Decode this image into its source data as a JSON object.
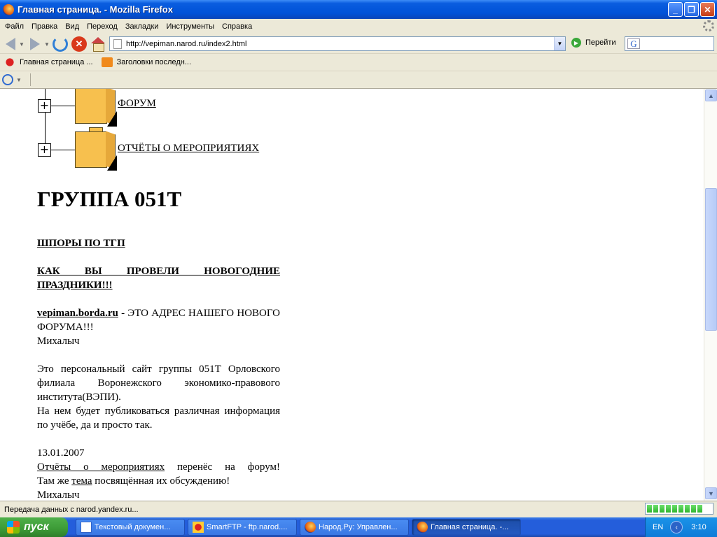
{
  "window": {
    "title": "Главная страница. - Mozilla Firefox"
  },
  "menu": [
    "Файл",
    "Правка",
    "Вид",
    "Переход",
    "Закладки",
    "Инструменты",
    "Справка"
  ],
  "nav": {
    "url": "http://vepiman.narod.ru/index2.html",
    "go_label": "Перейти",
    "search_placeholder": ""
  },
  "bookmarks": [
    {
      "label": "Главная страница ...",
      "icon": "page-icon"
    },
    {
      "label": "Заголовки последн...",
      "icon": "rss-icon"
    }
  ],
  "content": {
    "tree": [
      {
        "label": "ФОРУМ"
      },
      {
        "label": "ОТЧЁТЫ О МЕРОПРИЯТИЯХ"
      }
    ],
    "heading": "ГРУППА 051Т",
    "link_shpory": "ШПОРЫ ПО ТГП",
    "link_holidays": "КАК ВЫ ПРОВЕЛИ НОВОГОДНИЕ ПРАЗДНИКИ!!!",
    "forum_link": "vepiman.borda.ru",
    "forum_text": " - ЭТО АДРЕС НАШЕГО НОВОГО ФОРУМА!!!",
    "signature1": "Михалыч",
    "about1": "Это персональный сайт группы 051Т Орловского филиала Воронежского экономико-правового института(ВЭПИ).",
    "about2": "На нем будет публиковаться различная информация по учёбе, да и просто так.",
    "news_date": "13.01.2007",
    "news_link1": "Отчёты о мероприятиях",
    "news_text1": " перенёс на форум!",
    "news_text2a": "Там же ",
    "news_link2": "тема",
    "news_text2b": " посвящённая их обсуждению!",
    "signature2": "Михалыч"
  },
  "status": {
    "text": "Передача данных с narod.yandex.ru...",
    "progress": 0.9
  },
  "taskbar": {
    "start": "пуск",
    "tasks": [
      {
        "label": "Текстовый докумен...",
        "icon": "document-icon"
      },
      {
        "label": "SmartFTP - ftp.narod....",
        "icon": "smartftp-icon"
      },
      {
        "label": "Народ.Ру: Управлен...",
        "icon": "firefox-icon"
      },
      {
        "label": "Главная страница. -...",
        "icon": "firefox-icon",
        "active": true
      }
    ],
    "lang": "EN",
    "clock": "3:10"
  }
}
